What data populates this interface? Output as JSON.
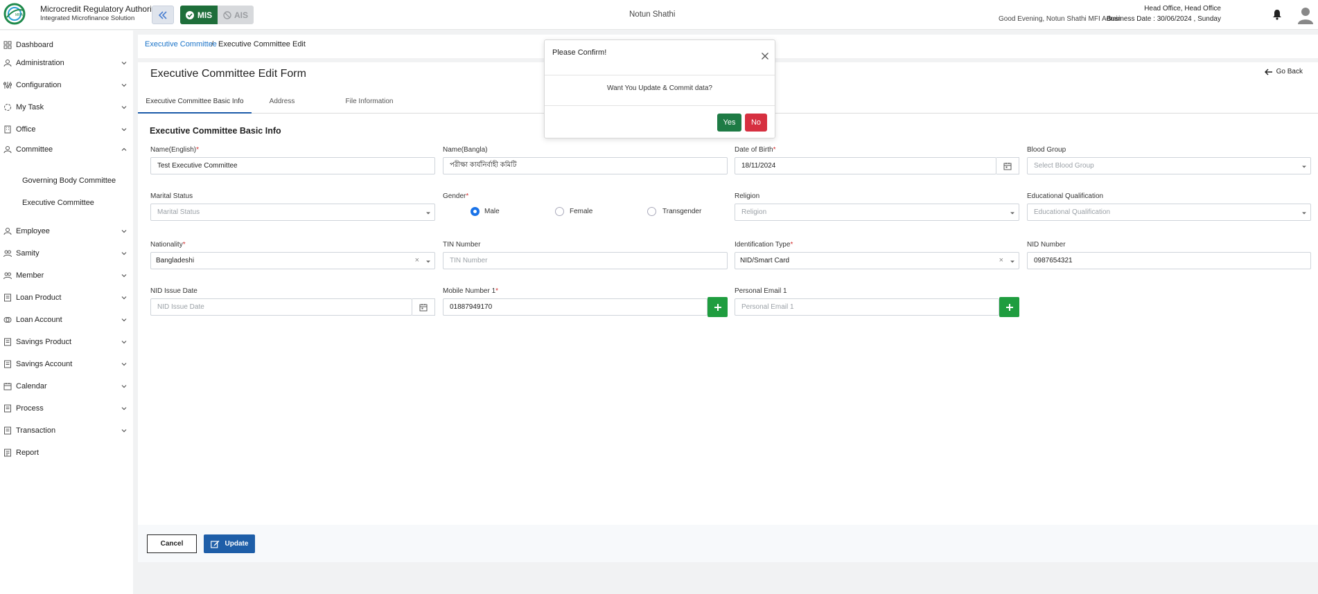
{
  "header": {
    "brand_title": "Microcredit Regulatory Authority",
    "brand_subtitle": "Integrated Microfinance Solution",
    "mode_mis": "MIS",
    "mode_ais": "AIS",
    "org_name": "Notun Shathi",
    "greeting": "Good Evening, Notun Shathi MFI Admin",
    "office": "Head Office, Head Office",
    "business_date": "Business Date : 30/06/2024 , Sunday"
  },
  "sidebar": {
    "items": [
      {
        "label": "Dashboard",
        "icon": "dashboard-icon"
      },
      {
        "label": "Administration",
        "icon": "admin-icon"
      },
      {
        "label": "Configuration",
        "icon": "config-icon"
      },
      {
        "label": "My Task",
        "icon": "task-icon"
      },
      {
        "label": "Office",
        "icon": "office-icon"
      },
      {
        "label": "Committee",
        "icon": "committee-icon"
      },
      {
        "label": "Employee",
        "icon": "employee-icon"
      },
      {
        "label": "Samity",
        "icon": "samity-icon"
      },
      {
        "label": "Member",
        "icon": "member-icon"
      },
      {
        "label": "Loan Product",
        "icon": "loan-product-icon"
      },
      {
        "label": "Loan Account",
        "icon": "loan-account-icon"
      },
      {
        "label": "Savings Product",
        "icon": "savings-product-icon"
      },
      {
        "label": "Savings Account",
        "icon": "savings-account-icon"
      },
      {
        "label": "Calendar",
        "icon": "calendar-icon"
      },
      {
        "label": "Process",
        "icon": "process-icon"
      },
      {
        "label": "Transaction",
        "icon": "transaction-icon"
      },
      {
        "label": "Report",
        "icon": "report-icon"
      }
    ],
    "committee_sub": [
      "Governing Body Committee",
      "Executive Committee"
    ]
  },
  "breadcrumb": {
    "link": "Executive Committee",
    "separator": "/",
    "current": "Executive Committee Edit"
  },
  "form": {
    "title": "Executive Committee Edit Form",
    "go_back": "Go Back",
    "tabs": [
      "Executive Committee Basic Info",
      "Address",
      "File Information"
    ],
    "section_title": "Executive Committee Basic Info",
    "fields": {
      "name_english": {
        "label": "Name(English)",
        "value": "Test Executive Committee"
      },
      "name_bangla": {
        "label": "Name(Bangla)",
        "value": "পরীক্ষা কার্যনির্বাহী কমিটি"
      },
      "dob": {
        "label": "Date of Birth",
        "value": "18/11/2024"
      },
      "blood_group": {
        "label": "Blood Group",
        "placeholder": "Select Blood Group"
      },
      "marital_status": {
        "label": "Marital Status",
        "placeholder": "Marital Status"
      },
      "gender": {
        "label": "Gender",
        "options": [
          "Male",
          "Female",
          "Transgender"
        ],
        "selected": "Male"
      },
      "religion": {
        "label": "Religion",
        "placeholder": "Religion"
      },
      "education": {
        "label": "Educational Qualification",
        "placeholder": "Educational Qualification"
      },
      "nationality": {
        "label": "Nationality",
        "value": "Bangladeshi"
      },
      "tin": {
        "label": "TIN Number",
        "placeholder": "TIN Number"
      },
      "id_type": {
        "label": "Identification Type",
        "value": "NID/Smart Card"
      },
      "nid_number": {
        "label": "NID Number",
        "value": "0987654321"
      },
      "nid_issue_date": {
        "label": "NID Issue Date",
        "placeholder": "NID Issue Date"
      },
      "mobile1": {
        "label": "Mobile Number 1",
        "value": "01887949170"
      },
      "email1": {
        "label": "Personal Email 1",
        "placeholder": "Personal Email 1"
      }
    },
    "required_mark": "*",
    "cancel": "Cancel",
    "update": "Update"
  },
  "modal": {
    "title": "Please Confirm!",
    "message": "Want You Update & Commit data?",
    "yes": "Yes",
    "no": "No"
  },
  "colors": {
    "mis_green": "#1e6e3a",
    "update_blue": "#1e5ea8",
    "plus_green": "#1f9d3f",
    "yes_green": "#1e7b45",
    "no_red": "#d63040",
    "link_blue": "#1a73c8"
  }
}
